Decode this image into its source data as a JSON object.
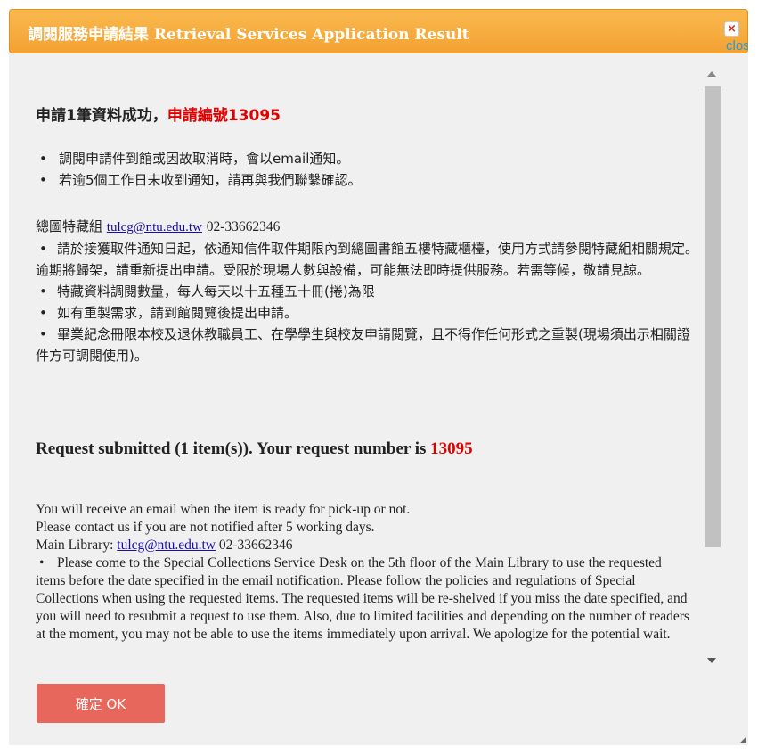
{
  "dialog": {
    "title": "調閱服務申請結果 Retrieval Services Application Result",
    "close_icon": "×",
    "close_label": "close",
    "ok_label": "確定 OK"
  },
  "zh": {
    "heading_success": "申請1筆資料成功，",
    "heading_number": "申請編號13095",
    "notes": [
      "調閱申請件到館或因故取消時，會以email通知。",
      "若逾5個工作日未收到通知，請再與我們聯繫確認。"
    ],
    "contact_label": "總圖特藏組",
    "email": "tulcg@ntu.edu.tw",
    "phone": "02-33662346",
    "rules": [
      "請於接獲取件通知日起，依通知信件取件期限內到總圖書館五樓特藏櫃檯，使用方式請參閱特藏組相關規定。逾期將歸架，請重新提出申請。受限於現場人數與設備，可能無法即時提供服務。若需等候，敬請見諒。",
      "特藏資料調閱數量，每人每天以十五種五十冊(捲)為限",
      "如有重製需求，請到館閱覽後提出申請。",
      "畢業紀念冊限本校及退休教職員工、在學學生與校友申請閱覽，且不得作任何形式之重製(現場須出示相關證件方可調閱使用)。"
    ]
  },
  "en": {
    "heading_prefix": "Request submitted (1 item(s)). Your request number is ",
    "request_number": "13095",
    "line1": "You will receive an email when the item is ready for pick-up or not.",
    "line2": "Please contact us if you are not notified after 5 working days.",
    "contact_label": "Main Library: ",
    "rule1": "Please come to the Special Collections Service Desk on the 5th floor of the Main Library to use the requested items before the date specified in the email notification. Please follow the policies and regulations of Special Collections when using the requested items. The requested items will be re-shelved if you miss the date specified, and you will need to resubmit a request to use them. Also, due to limited facilities and depending on the number of readers at the moment, you may not be able to use the items immediately upon arrival. We apologize for the potential wait."
  },
  "colors": {
    "titlebar": "#f4a233",
    "ok_button": "#e8675c",
    "highlight": "#e00000",
    "link": "#1a0dab"
  }
}
